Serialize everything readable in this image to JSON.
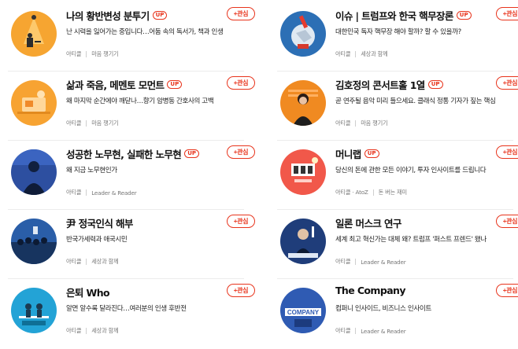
{
  "follow_label": "+관심",
  "badge_label": "UP",
  "accent_color": "#e8341c",
  "cards": [
    {
      "title": "나의 황반변성 분투기",
      "badge": true,
      "desc": "난 시력을 잃어가는 중입니다…어둠 속의 독서가, 책과 인생",
      "meta": [
        "아티클",
        "마음 챙기기"
      ],
      "thumb": "orange-lamp-reader"
    },
    {
      "title": "이슈 | 트럼프와 한국 핵무장론",
      "badge": true,
      "desc": "대한민국 독자 핵무장 해야 할까? 할 수 있을까?",
      "meta": [
        "아티클",
        "세상과 함께"
      ],
      "thumb": "blue-globe-missile"
    },
    {
      "title": "삶과 죽음, 메멘토 모먼트",
      "badge": true,
      "desc": "왜 마지막 순간에야 깨닫나…향기 암병동 간호사의 고백",
      "meta": [
        "아티클",
        "마음 챙기기"
      ],
      "thumb": "orange-hospital"
    },
    {
      "title": "김호정의 콘서트홀 1열",
      "badge": true,
      "desc": "곧 연주될 음악 미리 들으세요. 클래식 정통 기자가 짚는 핵심",
      "meta": [
        "아티클",
        "마음 챙기기"
      ],
      "thumb": "orange-portrait"
    },
    {
      "title": "성공한 노무현, 실패한 노무현",
      "badge": true,
      "desc": "왜 지금 노무현인가",
      "meta": [
        "아티클",
        "Leader & Reader"
      ],
      "thumb": "blue-silhouette"
    },
    {
      "title": "머니랩",
      "badge": true,
      "desc": "당신의 돈에 관한 모든 이야기, 투자 인사이트를 드립니다",
      "meta": [
        "아티클 · AtoZ",
        "돈 버는 재미"
      ],
      "thumb": "red-moneylab"
    },
    {
      "title": "尹 정국인식 해부",
      "badge": false,
      "desc": "반국가세력과 애국시민",
      "meta": [
        "아티클",
        "세상과 함께"
      ],
      "thumb": "blue-crowd"
    },
    {
      "title": "일론 머스크 연구",
      "badge": false,
      "desc": "세계 최고 혁신가는 대체 왜? 트럼프 '퍼스트 프렌드' 됐나",
      "meta": [
        "아티클",
        "Leader & Reader"
      ],
      "thumb": "navy-musk"
    },
    {
      "title": "은퇴 Who",
      "badge": false,
      "desc": "알면 알수록 달라진다…여러분의 인생 후반전",
      "meta": [
        "아티클",
        "세상과 함께"
      ],
      "thumb": "teal-retire"
    },
    {
      "title": "The Company",
      "badge": false,
      "desc": "컴퍼니 인사이드, 비즈니스 인사이트",
      "meta": [
        "아티클",
        "Leader & Reader"
      ],
      "thumb": "blue-company"
    }
  ]
}
